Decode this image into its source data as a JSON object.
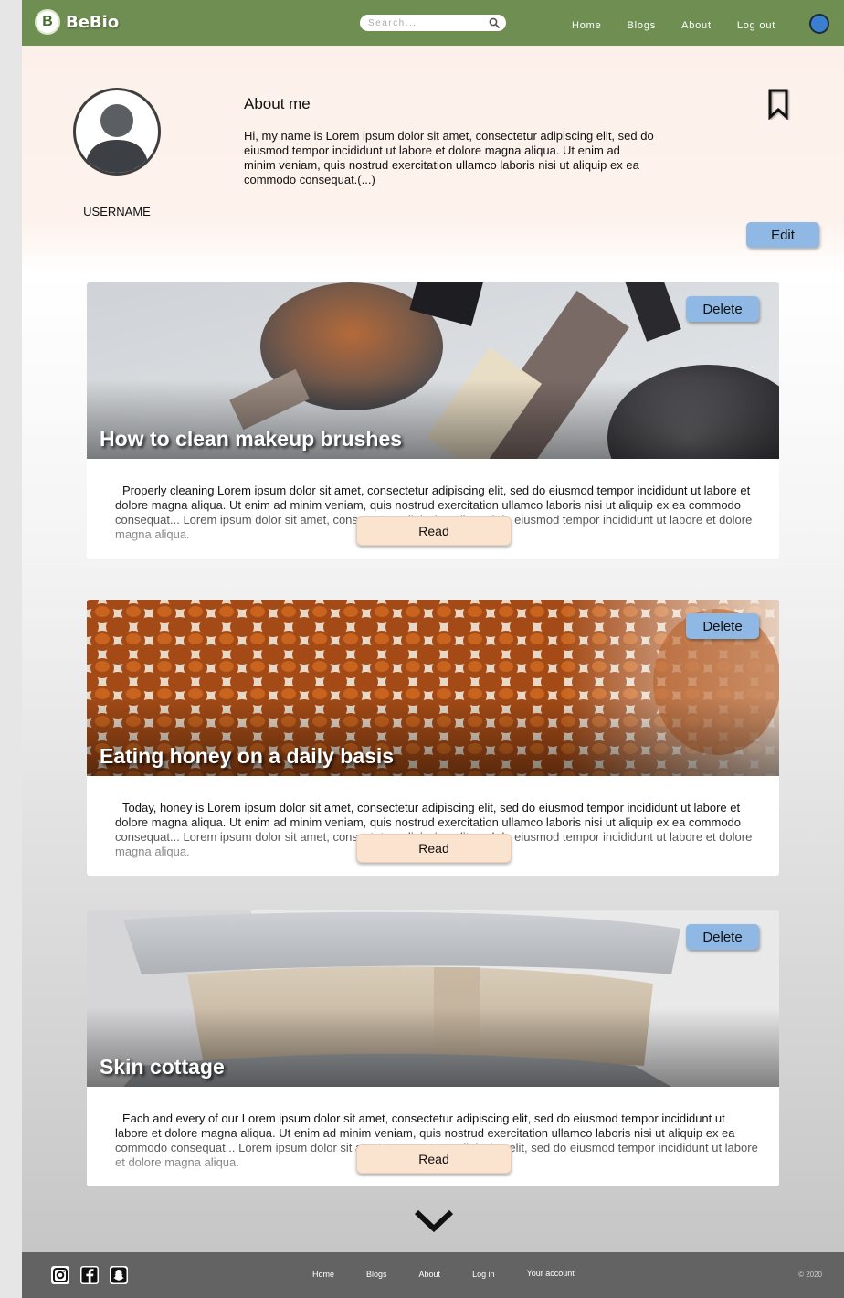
{
  "nav": {
    "logo_letter": "B",
    "logo_text": "BeBio",
    "search_placeholder": "Search...",
    "links": [
      "Home",
      "Blogs",
      "About",
      "Log out"
    ]
  },
  "profile": {
    "username": "USERNAME",
    "about_title": "About me",
    "about_text": "Hi, my name is Lorem ipsum dolor sit amet, consectetur adipiscing elit, sed do eiusmod tempor incididunt ut labore et dolore magna aliqua. Ut enim ad minim veniam, quis nostrud exercitation ullamco laboris nisi ut aliquip ex ea commodo consequat.(...)",
    "edit_label": "Edit"
  },
  "posts": [
    {
      "title": "How to clean makeup brushes",
      "delete_label": "Delete",
      "excerpt": "Properly cleaning Lorem ipsum dolor sit amet, consectetur adipiscing elit, sed do eiusmod tempor incididunt ut labore et dolore magna aliqua. Ut enim ad minim veniam, quis nostrud exercitation ullamco laboris nisi ut aliquip ex ea commodo consequat... Lorem ipsum dolor sit amet, consectetur adipiscing elit, sed do eiusmod tempor incididunt ut labore et dolore magna aliqua.",
      "read_label": "Read"
    },
    {
      "title": "Eating honey on a daily basis",
      "delete_label": "Delete",
      "excerpt": "Today, honey is Lorem ipsum dolor sit amet, consectetur adipiscing elit, sed do eiusmod tempor incididunt ut labore et dolore magna aliqua. Ut enim ad minim veniam, quis nostrud exercitation ullamco laboris nisi ut aliquip ex ea commodo consequat... Lorem ipsum dolor sit amet, consectetur adipiscing elit, sed do eiusmod tempor incididunt ut labore et dolore magna aliqua.",
      "read_label": "Read"
    },
    {
      "title": "Skin cottage",
      "delete_label": "Delete",
      "excerpt": "Each and every of our Lorem ipsum dolor sit amet, consectetur adipiscing elit, sed do eiusmod tempor incididunt ut labore et dolore magna aliqua. Ut enim ad minim veniam, quis nostrud exercitation ullamco laboris nisi ut aliquip ex ea commodo consequat... Lorem ipsum dolor sit amet, consectetur adipiscing elit, sed do eiusmod tempor incididunt ut labore et dolore magna aliqua.",
      "read_label": "Read"
    }
  ],
  "footer": {
    "links": [
      "Home",
      "Blogs",
      "About",
      "Log in",
      "Your account"
    ],
    "copyright": "© 2020",
    "social_icons": [
      "instagram-icon",
      "facebook-icon",
      "snapchat-icon"
    ]
  },
  "colors": {
    "nav_green": "#6f8f52",
    "button_blue": "#8fb8e4",
    "read_peach": "#fbe4cf",
    "footer_gray": "#636363"
  }
}
